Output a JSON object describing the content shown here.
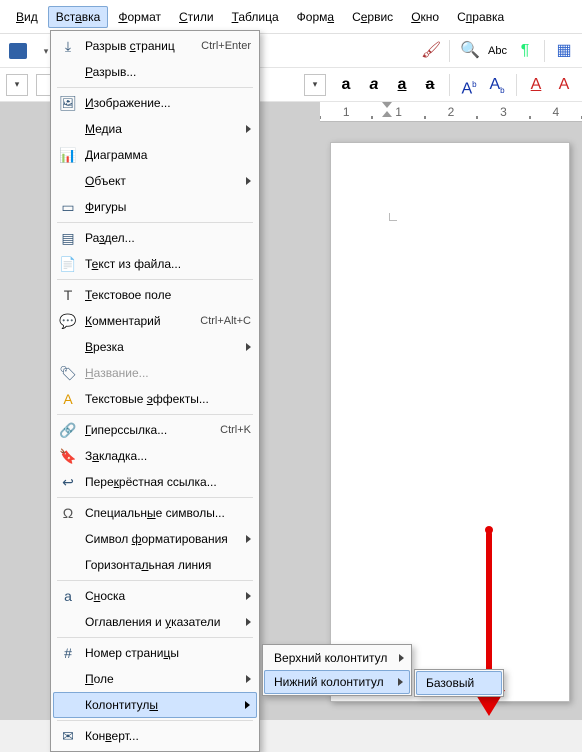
{
  "menubar": {
    "items": [
      {
        "label": "Вид",
        "ul": "В"
      },
      {
        "label": "Вставка",
        "ul": "а",
        "active": true
      },
      {
        "label": "Формат",
        "ul": "Ф"
      },
      {
        "label": "Стили",
        "ul": "С"
      },
      {
        "label": "Таблица",
        "ul": "Т"
      },
      {
        "label": "Форма",
        "ul": "а"
      },
      {
        "label": "Сервис",
        "ul": "е"
      },
      {
        "label": "Окно",
        "ul": "О"
      },
      {
        "label": "Справка",
        "ul": "п"
      }
    ]
  },
  "insert_menu": {
    "items": [
      {
        "icon": "page-break-icon",
        "label": "Разрыв страниц",
        "ul": "с",
        "accel": "Ctrl+Enter"
      },
      {
        "icon": null,
        "label": "Разрыв...",
        "ul": "Р"
      },
      {
        "sep": true
      },
      {
        "icon": "image-icon",
        "label": "Изображение...",
        "ul": "И"
      },
      {
        "icon": null,
        "label": "Медиа",
        "ul": "М",
        "sub": true
      },
      {
        "icon": "chart-icon",
        "label": "Диаграмма",
        "ul": "Д"
      },
      {
        "icon": null,
        "label": "Объект",
        "ul": "О",
        "sub": true
      },
      {
        "icon": "shapes-icon",
        "label": "Фигуры",
        "ul": "Ф"
      },
      {
        "sep": true
      },
      {
        "icon": "section-icon",
        "label": "Раздел...",
        "ul": "з"
      },
      {
        "icon": "text-file-icon",
        "label": "Текст из файла...",
        "ul": "е"
      },
      {
        "sep": true
      },
      {
        "icon": "textbox-icon",
        "label": "Текстовое поле",
        "ul": "Т"
      },
      {
        "icon": "comment-icon",
        "label": "Комментарий",
        "ul": "К",
        "accel": "Ctrl+Alt+C"
      },
      {
        "icon": null,
        "label": "Врезка",
        "ul": "В",
        "sub": true
      },
      {
        "icon": "caption-icon",
        "label": "Название...",
        "ul": "Н",
        "disabled": true
      },
      {
        "icon": "texteffects-icon",
        "label": "Текстовые эффекты...",
        "ul": "э"
      },
      {
        "sep": true
      },
      {
        "icon": "hyperlink-icon",
        "label": "Гиперссылка...",
        "ul": "Г",
        "accel": "Ctrl+K"
      },
      {
        "icon": "bookmark-icon",
        "label": "Закладка...",
        "ul": "а"
      },
      {
        "icon": "crossref-icon",
        "label": "Перекрёстная ссылка...",
        "ul": "к"
      },
      {
        "sep": true
      },
      {
        "icon": "omega-icon",
        "label": "Специальные символы...",
        "ul": "ы"
      },
      {
        "icon": null,
        "label": "Символ форматирования",
        "ul": "ф",
        "sub": true
      },
      {
        "icon": null,
        "label": "Горизонтальная линия",
        "ul": "л"
      },
      {
        "sep": true
      },
      {
        "icon": "footnote-icon",
        "label": "Сноска",
        "ul": "н",
        "sub": true
      },
      {
        "icon": null,
        "label": "Оглавления и указатели",
        "ul": "у",
        "sub": true
      },
      {
        "sep": true
      },
      {
        "icon": "pagenum-icon",
        "label": "Номер страницы",
        "ul": "ц"
      },
      {
        "icon": null,
        "label": "Поле",
        "ul": "П",
        "sub": true
      },
      {
        "icon": null,
        "label": "Колонтитулы",
        "ul": "ы",
        "sub": true,
        "hover": true
      },
      {
        "sep": true
      },
      {
        "icon": "envelope-icon",
        "label": "Конверт...",
        "ul": "в"
      }
    ]
  },
  "submenu1": {
    "items": [
      {
        "label": "Верхний колонтитул",
        "ul": "В",
        "sub": true
      },
      {
        "label": "Нижний колонтитул",
        "ul": "Н",
        "sub": true,
        "hover": true
      }
    ]
  },
  "submenu2": {
    "items": [
      {
        "label": "Базовый",
        "hover": true
      }
    ]
  },
  "ruler": {
    "marks": [
      "1",
      "1",
      "2",
      "3",
      "4"
    ]
  }
}
